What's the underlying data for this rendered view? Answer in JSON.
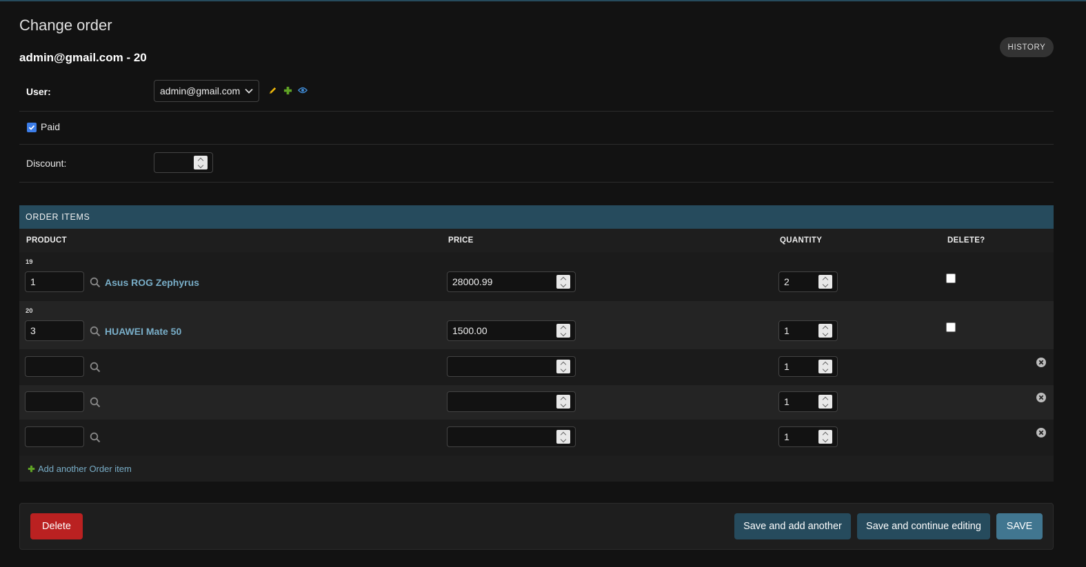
{
  "header": {
    "page_title": "Change order",
    "object_title": "admin@gmail.com - 20",
    "history_label": "HISTORY"
  },
  "form": {
    "user_label": "User:",
    "user_value": "admin@gmail.com",
    "paid_label": "Paid",
    "paid_checked": true,
    "discount_label": "Discount:",
    "discount_value": ""
  },
  "inline": {
    "title": "ORDER ITEMS",
    "columns": [
      "PRODUCT",
      "PRICE",
      "QUANTITY",
      "DELETE?"
    ],
    "rows": [
      {
        "id": "19",
        "product_id": "1",
        "product_name": "Asus ROG Zephyrus",
        "price": "28000.99",
        "quantity": "2"
      },
      {
        "id": "20",
        "product_id": "3",
        "product_name": "HUAWEI Mate 50",
        "price": "1500.00",
        "quantity": "1"
      },
      {
        "id": "",
        "product_id": "",
        "product_name": "",
        "price": "",
        "quantity": "1"
      },
      {
        "id": "",
        "product_id": "",
        "product_name": "",
        "price": "",
        "quantity": "1"
      },
      {
        "id": "",
        "product_id": "",
        "product_name": "",
        "price": "",
        "quantity": "1"
      }
    ],
    "add_label": "Add another Order item"
  },
  "buttons": {
    "delete": "Delete",
    "save_add": "Save and add another",
    "save_continue": "Save and continue editing",
    "save": "SAVE"
  },
  "colors": {
    "background": "#121212",
    "header_bar": "#264b5d",
    "link": "#79aec8",
    "delete": "#ba2121",
    "save": "#417690"
  },
  "icons": [
    "pencil-icon",
    "plus-icon",
    "eye-icon",
    "search-icon",
    "remove-icon",
    "chevron-down-icon",
    "checkmark-icon"
  ]
}
